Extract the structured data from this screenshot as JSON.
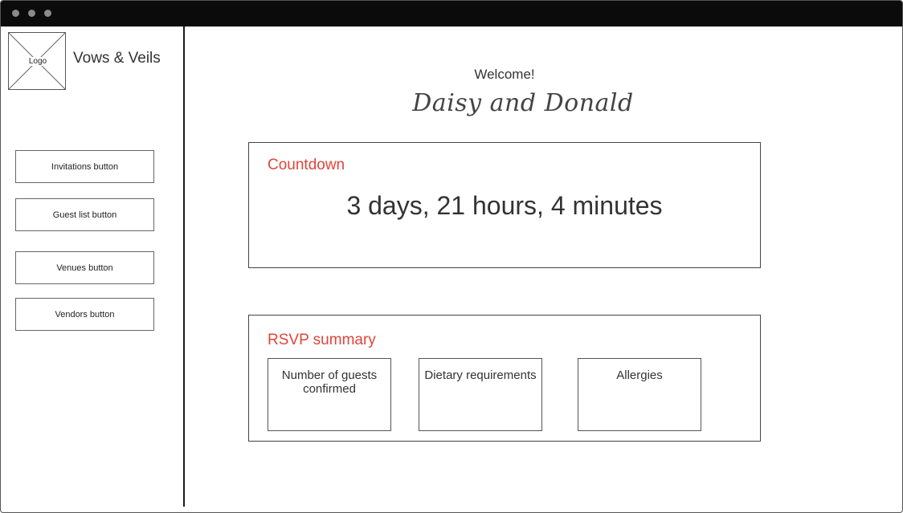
{
  "window": {
    "titlebar_color": "#0b0b0b",
    "dots": [
      "window-dot",
      "window-dot",
      "window-dot"
    ]
  },
  "sidebar": {
    "logo_label": "Logo",
    "app_name": "Vows & Veils",
    "nav": [
      {
        "label": "Invitations button"
      },
      {
        "label": "Guest list button"
      },
      {
        "label": "Venues button"
      },
      {
        "label": "Vendors button"
      }
    ]
  },
  "main": {
    "welcome": "Welcome!",
    "couple_names": "Daisy and Donald",
    "countdown": {
      "title": "Countdown",
      "value": "3 days, 21 hours, 4 minutes"
    },
    "rsvp": {
      "title": "RSVP summary",
      "cards": [
        {
          "label": "Number of guests confirmed"
        },
        {
          "label": "Dietary requirements"
        },
        {
          "label": "Allergies"
        }
      ]
    }
  },
  "colors": {
    "accent": "#e0453a",
    "border": "#444444",
    "text": "#333333"
  }
}
